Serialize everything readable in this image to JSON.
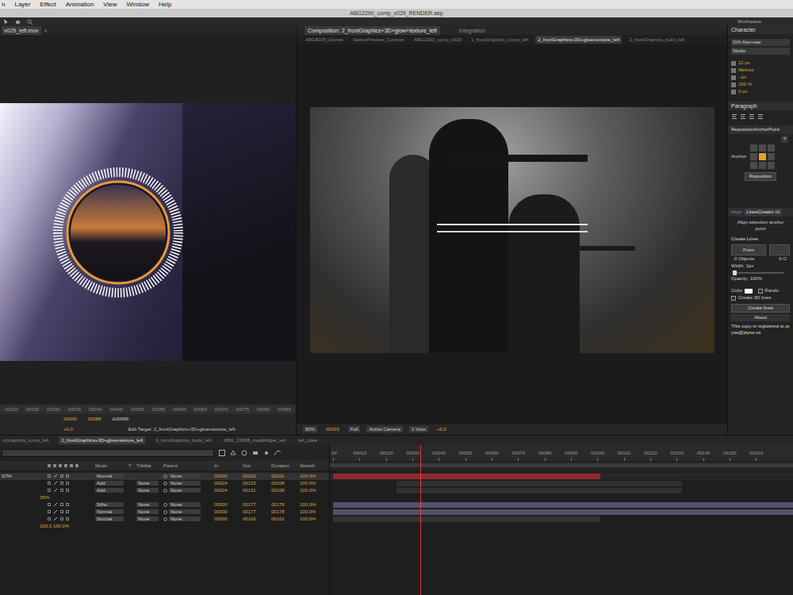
{
  "menu": [
    "n",
    "Layer",
    "Effect",
    "Animation",
    "View",
    "Window",
    "Help"
  ],
  "window": {
    "title": "ABG2290_comp_v029_RENDER.aep"
  },
  "toolbar": {
    "workspace": "Workspace"
  },
  "footage_panel": {
    "tab": "v029_left.mov",
    "close": "×",
    "ruler": [
      "00020",
      "00025",
      "00030",
      "00035",
      "00040",
      "00045",
      "00050",
      "00055",
      "00060",
      "00065",
      "00070",
      "00075",
      "00080",
      "00085"
    ],
    "start": "00000",
    "end": "00088",
    "duration": "Δ00089",
    "exposure": "+0.0",
    "edit_target": "Edit Target: 2_frontGraphics+3D+glow+texture_left"
  },
  "comp_panel": {
    "tabs": [
      {
        "label": "Composition: 2_frontGraphics+3D+glow+texture_left",
        "selected": true
      },
      {
        "label": "Integration",
        "selected": false
      }
    ],
    "subtabs": [
      {
        "label": "ABG8105_Stories",
        "selected": false
      },
      {
        "label": "StereoPreview_Controls",
        "selected": false
      },
      {
        "label": "ABG2290_comp_v029",
        "selected": false
      },
      {
        "label": "1_frontGraphics_comp_left",
        "selected": false
      },
      {
        "label": "2_frontGraphics+3D+glow+texture_left",
        "selected": true
      },
      {
        "label": "3_frontGraphics_build_left",
        "selected": false
      }
    ],
    "zoom": "50%",
    "time": "00033",
    "resolution": "Full",
    "camera": "Active Camera",
    "views": "1 View",
    "exposure": "+0.0"
  },
  "character": {
    "title": "Character",
    "font": "DIN Alternate",
    "style": "Medio",
    "size": "12 px",
    "kerning": "Metrics",
    "leading": "- px",
    "scale": "100 %",
    "baseline": "0 px"
  },
  "paragraph": {
    "title": "Paragraph"
  },
  "reposition": {
    "title": "RepositionAnchorPoint",
    "help": "?",
    "label": "Anchor:",
    "anchors": [
      {
        "selected": false
      },
      {
        "selected": false
      },
      {
        "selected": false
      },
      {
        "selected": false
      },
      {
        "selected": true
      },
      {
        "selected": false
      },
      {
        "selected": false
      },
      {
        "selected": false
      },
      {
        "selected": false
      }
    ],
    "button": "Reposition"
  },
  "lines_creator": {
    "tabs": [
      {
        "label": "Align",
        "selected": false
      },
      {
        "label": "LinesCreator v1",
        "selected": true
      }
    ],
    "align_label": "Align selection anchor point",
    "heading": "Create Lines",
    "from": "From",
    "objects": "0 Objects",
    "objects_to": "0 O",
    "width": "Width: 1px",
    "opacity_level": 0.05,
    "opacity": "Opacity: 100%",
    "color_label": "Color",
    "random": {
      "label": "Rando",
      "checked": false
    },
    "lines3d": {
      "label": "Create 3D lines",
      "checked": false
    },
    "create": "Create lines",
    "about": "About",
    "registered": "This copy is registered to jayse@jayse.us"
  },
  "timeline": {
    "tabs": [
      {
        "label": "mGraphics_comp_left",
        "selected": false
      },
      {
        "label": "2_frontGraphics+3D+glow+texture_left",
        "selected": true
      },
      {
        "label": "3_frontGraphics_build_left",
        "selected": false
      },
      {
        "label": "ABG_22968_mapWidget_left",
        "selected": false
      },
      {
        "label": "left_plate",
        "selected": false
      }
    ],
    "columns": [
      "Mode",
      "T",
      "TrkMat",
      "Parent",
      "In",
      "Out",
      "Duration",
      "Stretch"
    ],
    "ruler": [
      "00",
      "00010",
      "00020",
      "00030",
      "00040",
      "00050",
      "00060",
      "00070",
      "00080",
      "00090",
      "00100",
      "00110",
      "00120",
      "00130",
      "00140",
      "00150",
      "00160"
    ],
    "layers": [
      {
        "kind": "layer",
        "name": "GTH",
        "mode": "Normal",
        "parent": "None",
        "in": "00000",
        "out": "00100",
        "duration": "00101",
        "stretch": "100.0%",
        "selected": true,
        "color": "#8e2a2a"
      },
      {
        "kind": "layer",
        "mode": "Add",
        "trkmat": "None",
        "parent": "None",
        "in": "00024",
        "out": "00133",
        "duration": "00108",
        "stretch": "100.0%",
        "selected": false,
        "color": "#303030"
      },
      {
        "kind": "layer",
        "mode": "Add",
        "trkmat": "None",
        "parent": "None",
        "in": "00024",
        "out": "00131",
        "duration": "00108",
        "stretch": "100.0%",
        "selected": false,
        "color": "#303030"
      },
      {
        "kind": "property",
        "value": "35%"
      },
      {
        "kind": "layer",
        "mode": "Silho",
        "trkmat": "None",
        "parent": "None",
        "in": "00000",
        "out": "00177",
        "duration": "00178",
        "stretch": "100.0%",
        "selected": false,
        "color": "#57506b"
      },
      {
        "kind": "layer",
        "mode": "Normal",
        "trkmat": "None",
        "parent": "None",
        "in": "00000",
        "out": "00177",
        "duration": "00178",
        "stretch": "100.0%",
        "selected": false,
        "color": "#57506b"
      },
      {
        "kind": "layer",
        "mode": "Normal",
        "trkmat": "None",
        "parent": "None",
        "in": "00000",
        "out": "00100",
        "duration": "00101",
        "stretch": "100.0%",
        "selected": false,
        "color": "#353535"
      },
      {
        "kind": "property",
        "value": "100.0,100.0%"
      }
    ]
  }
}
